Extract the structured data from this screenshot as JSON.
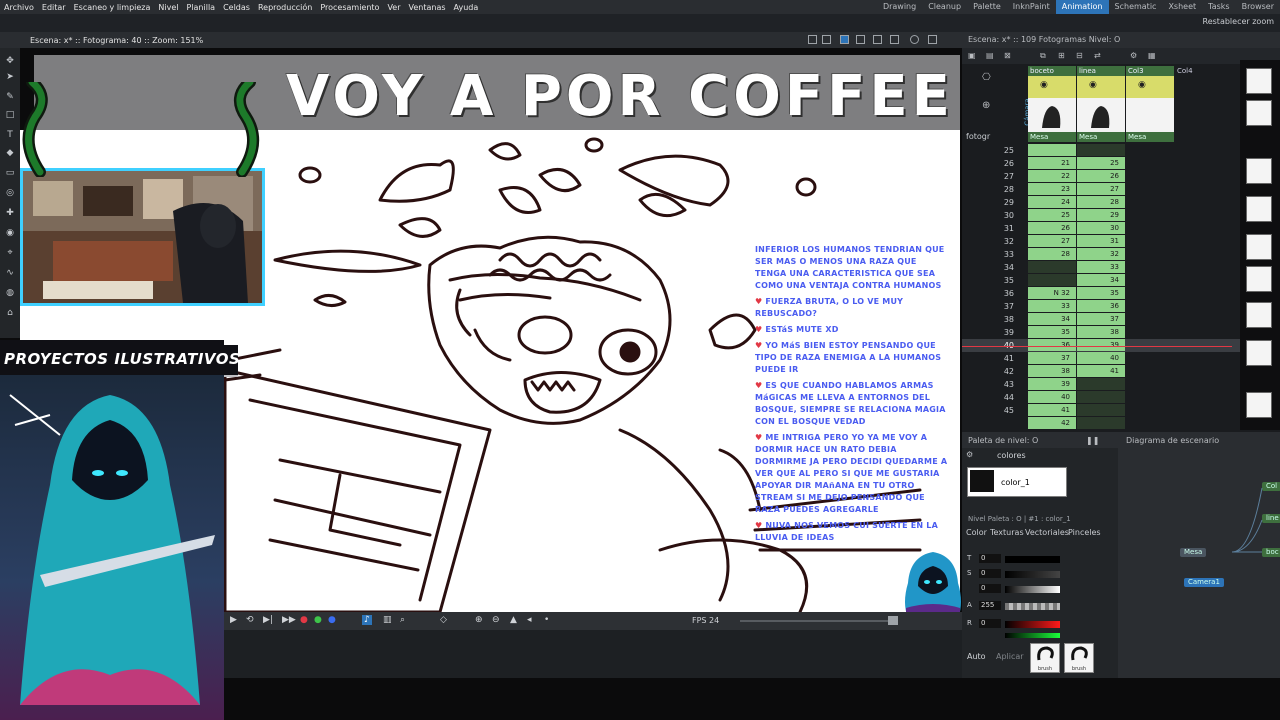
{
  "menu": [
    "Archivo",
    "Editar",
    "Escaneo y limpieza",
    "Nivel",
    "Planilla",
    "Celdas",
    "Reproducción",
    "Procesamiento",
    "Ver",
    "Ventanas",
    "Ayuda"
  ],
  "rooms": [
    "Drawing",
    "Cleanup",
    "Palette",
    "InknPaint",
    "Animation",
    "Schematic",
    "Xsheet",
    "Tasks",
    "Browser"
  ],
  "active_room": "Animation",
  "reset_zoom": "Restablecer zoom",
  "viewer": {
    "info": "Escena: x*  ::  Fotograma: 40  ::  Zoom: 151%"
  },
  "stream": {
    "title": "VOY A POR  COFFEE",
    "banner": "PROYECTOS ILUSTRATIVOS",
    "chat": [
      {
        "text": "INFERIOR LOS HUMANOS TENDRIAN QUE SER MAS O MENOS UNA RAZA QUE TENGA UNA CARACTERISTICA QUE SEA COMO UNA VENTAJA CONTRA HUMANOS"
      },
      {
        "text": "FUERZA BRUTA, O LO VE MUY REBUSCADO?"
      },
      {
        "text": "ESTáS MUTE XD"
      },
      {
        "text": "YO MáS BIEN ESTOY PENSANDO QUE TIPO DE RAZA ENEMIGA A LA HUMANOS PUEDE IR"
      },
      {
        "text": "ES QUE CUANDO HABLAMOS ARMAS MáGICAS ME LLEVA A ENTORNOS DEL BOSQUE, SIEMPRE SE RELACIONA MAGIA CON EL BOSQUE VEDAD"
      },
      {
        "text": "ME INTRIGA PERO YO YA ME VOY A DORMIR HACE UN RATO DEBIA DORMIRME JA PERO DECIDI QUEDARME A VER QUE AL PERO SI QUE ME GUSTARIA APOYAR DIR MAñANA EN TU OTRO STREAM SI ME DEJO PENSANDO QUE RAZA PUEDES AGREGARLE"
      },
      {
        "text": "NUVA NOS VEMOS CUI SUERTE EN LA LLUVIA DE IDEAS"
      }
    ]
  },
  "playback": {
    "fps_label": "FPS",
    "fps_value": "24"
  },
  "xsheet": {
    "info": "Escena: x* :: 109 Fotogramas  Nivel: O",
    "camera_label": "Cámara",
    "fotogr": "fotogr",
    "columns": [
      {
        "name": "boceto",
        "foot": "Mesa"
      },
      {
        "name": "linea",
        "foot": "Mesa"
      },
      {
        "name": "Col3",
        "foot": "Mesa"
      },
      {
        "name": "Col4",
        "foot": ""
      }
    ],
    "rows": [
      {
        "f": "25",
        "c1": "",
        "c2": ""
      },
      {
        "f": "26",
        "c1": "21",
        "c2": "25"
      },
      {
        "f": "27",
        "c1": "22",
        "c2": "26"
      },
      {
        "f": "28",
        "c1": "23",
        "c2": "27"
      },
      {
        "f": "29",
        "c1": "24",
        "c2": "28"
      },
      {
        "f": "30",
        "c1": "25",
        "c2": "29"
      },
      {
        "f": "31",
        "c1": "26",
        "c2": "30"
      },
      {
        "f": "32",
        "c1": "27",
        "c2": "31"
      },
      {
        "f": "33",
        "c1": "28",
        "c2": "32"
      },
      {
        "f": "34",
        "c1": "",
        "c2": "33"
      },
      {
        "f": "35",
        "c1": "",
        "c2": "34"
      },
      {
        "f": "36",
        "c1": "N  32",
        "c2": "35"
      },
      {
        "f": "37",
        "c1": "33",
        "c2": "36"
      },
      {
        "f": "38",
        "c1": "34",
        "c2": "37"
      },
      {
        "f": "39",
        "c1": "35",
        "c2": "38"
      },
      {
        "f": "40",
        "c1": "36",
        "c2": "39"
      },
      {
        "f": "41",
        "c1": "37",
        "c2": "40"
      },
      {
        "f": "42",
        "c1": "38",
        "c2": "41"
      },
      {
        "f": "43",
        "c1": "39",
        "c2": ""
      },
      {
        "f": "44",
        "c1": "40",
        "c2": ""
      },
      {
        "f": "45",
        "c1": "41",
        "c2": ""
      },
      {
        "f": "",
        "c1": "42",
        "c2": ""
      }
    ]
  },
  "palette": {
    "title": "Paleta de nivel: O",
    "colores": "colores",
    "swatch": "color_1",
    "path": "Nivel Paleta : O | #1 : color_1",
    "tabs": [
      "Color",
      "Texturas",
      "Vectoriales",
      "Pinceles"
    ],
    "sliders": [
      {
        "label": "T",
        "value": "0"
      },
      {
        "label": "S",
        "value": "0"
      },
      {
        "label": "",
        "value": "0"
      },
      {
        "label": "A",
        "value": "255"
      },
      {
        "label": "R",
        "value": "0"
      }
    ],
    "auto": "Auto",
    "aplicar": "Aplicar",
    "brush_label": "brush"
  },
  "schematic": {
    "title": "Diagrama de escenario",
    "nodes": [
      "Mesa",
      "Camera1",
      "Col",
      "line",
      "boc"
    ]
  },
  "colors": {
    "accent": "#2d74b8",
    "webcam_border": "#3fd0ff",
    "chat_text": "#4a5cf0",
    "cell_green": "#8fd38a",
    "current_frame": "#e23845"
  }
}
